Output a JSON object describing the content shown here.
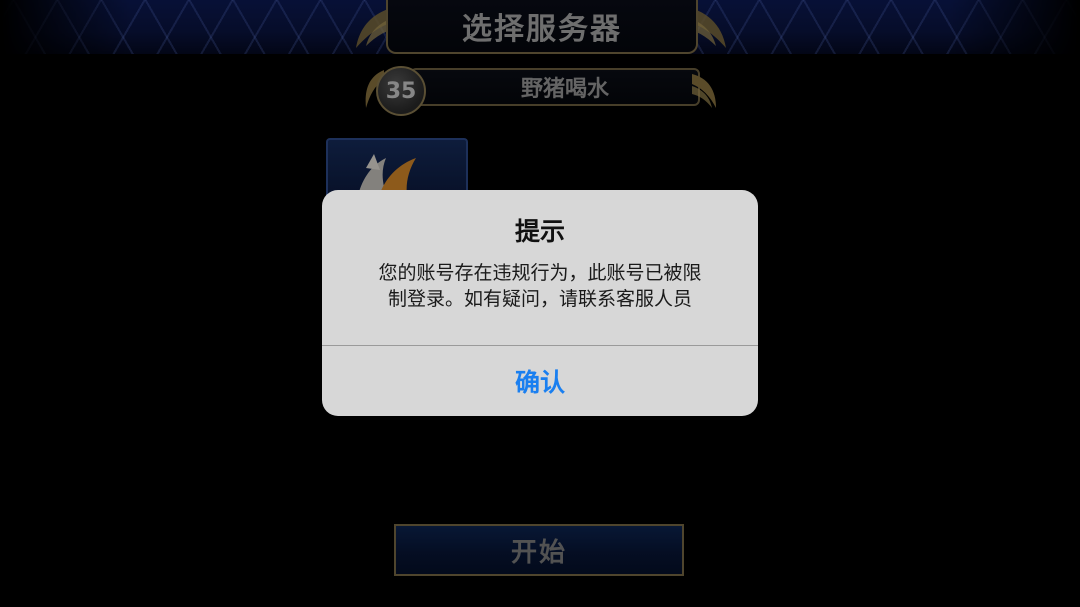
{
  "header": {
    "title": "选择服务器"
  },
  "server": {
    "number": "35",
    "name": "野猪喝水"
  },
  "start_button": {
    "label": "开始"
  },
  "dialog": {
    "title": "提示",
    "message_line1": "您的账号存在违规行为，此账号已被限",
    "message_line2": "制登录。如有疑问，请联系客服人员",
    "confirm_label": "确认"
  },
  "colors": {
    "confirm_text": "#1a7ff0",
    "dialog_bg": "#d7d7d7",
    "gold_trim": "#7a6a45"
  }
}
